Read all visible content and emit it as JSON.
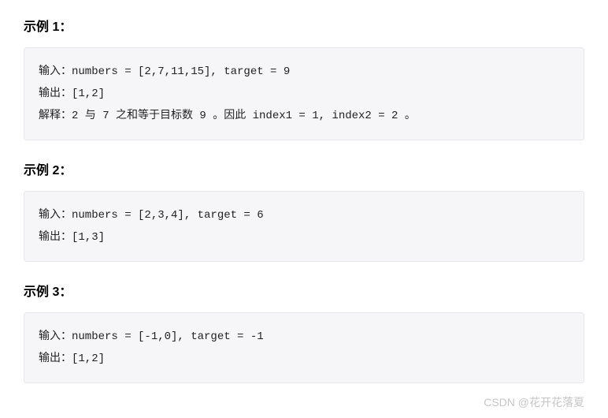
{
  "examples": [
    {
      "heading": "示例 1：",
      "lines": [
        "输入：numbers = [2,7,11,15], target = 9",
        "输出：[1,2]",
        "解释：2 与 7 之和等于目标数 9 。因此 index1 = 1, index2 = 2 。"
      ]
    },
    {
      "heading": "示例 2：",
      "lines": [
        "输入：numbers = [2,3,4], target = 6",
        "输出：[1,3]"
      ]
    },
    {
      "heading": "示例 3：",
      "lines": [
        "输入：numbers = [-1,0], target = -1",
        "输出：[1,2]"
      ]
    }
  ],
  "watermark": "CSDN @花开花落夏"
}
